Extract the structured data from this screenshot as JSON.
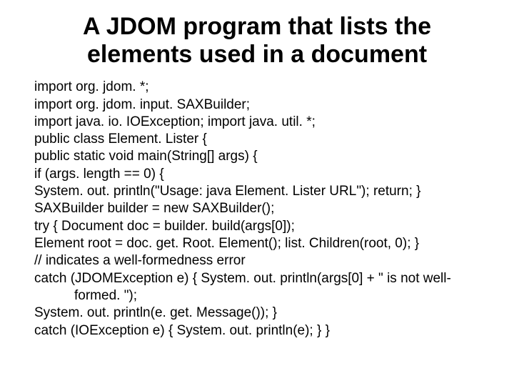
{
  "title": "A JDOM program that lists the elements used in a document",
  "code": {
    "l1": "import org. jdom. *;",
    "l2": " import org. jdom. input. SAXBuilder;",
    "l3": "import java. io. IOException; import java. util. *;",
    "l4": "public class Element. Lister {",
    "l5": "public static void main(String[] args) {",
    "l6": "if (args. length == 0) {",
    "l7": "System. out. println(\"Usage: java Element. Lister URL\"); return; }",
    "l8": " SAXBuilder builder = new SAXBuilder();",
    "l9": " try { Document doc = builder. build(args[0]);",
    "l10": "Element root = doc. get. Root. Element(); list. Children(root, 0); }",
    "l11": "// indicates a well-formedness error",
    "l12a": " catch (JDOMException e) { System. out. println(args[0] + \" is not well-",
    "l12b": "formed. \");",
    "l13": "System. out. println(e. get. Message()); }",
    "l14": " catch (IOException e) { System. out. println(e); } }"
  }
}
